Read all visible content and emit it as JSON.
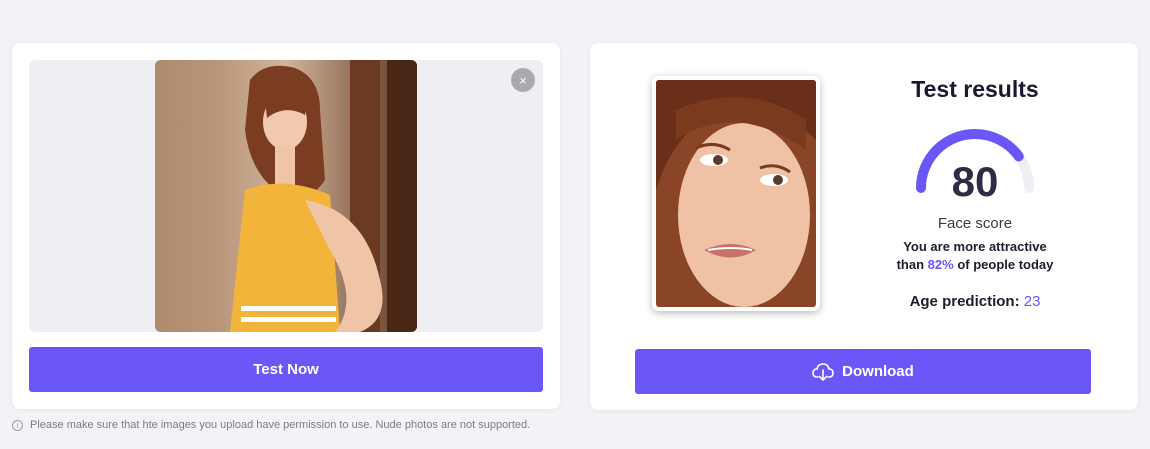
{
  "upload": {
    "photo_alt": "Uploaded photo",
    "remove_symbol": "×",
    "test_button": "Test Now"
  },
  "disclaimer": {
    "icon": "info-icon",
    "icon_glyph": "i",
    "text": "Please make sure that hte images you upload have permission to use. Nude photos are not supported."
  },
  "results": {
    "title": "Test results",
    "score": "80",
    "score_fraction": 0.8,
    "score_label": "Face score",
    "attract_line1": "You are more attractive",
    "attract_prefix": "than",
    "attract_percent": "82%",
    "attract_suffix": "of people today",
    "age_label": "Age prediction:",
    "age_value": "23",
    "download_button": "Download",
    "download_icon": "cloud-download-icon"
  },
  "colors": {
    "accent": "#6b57f8",
    "gauge_track": "#eeeef3",
    "background": "#f3f3f7"
  }
}
